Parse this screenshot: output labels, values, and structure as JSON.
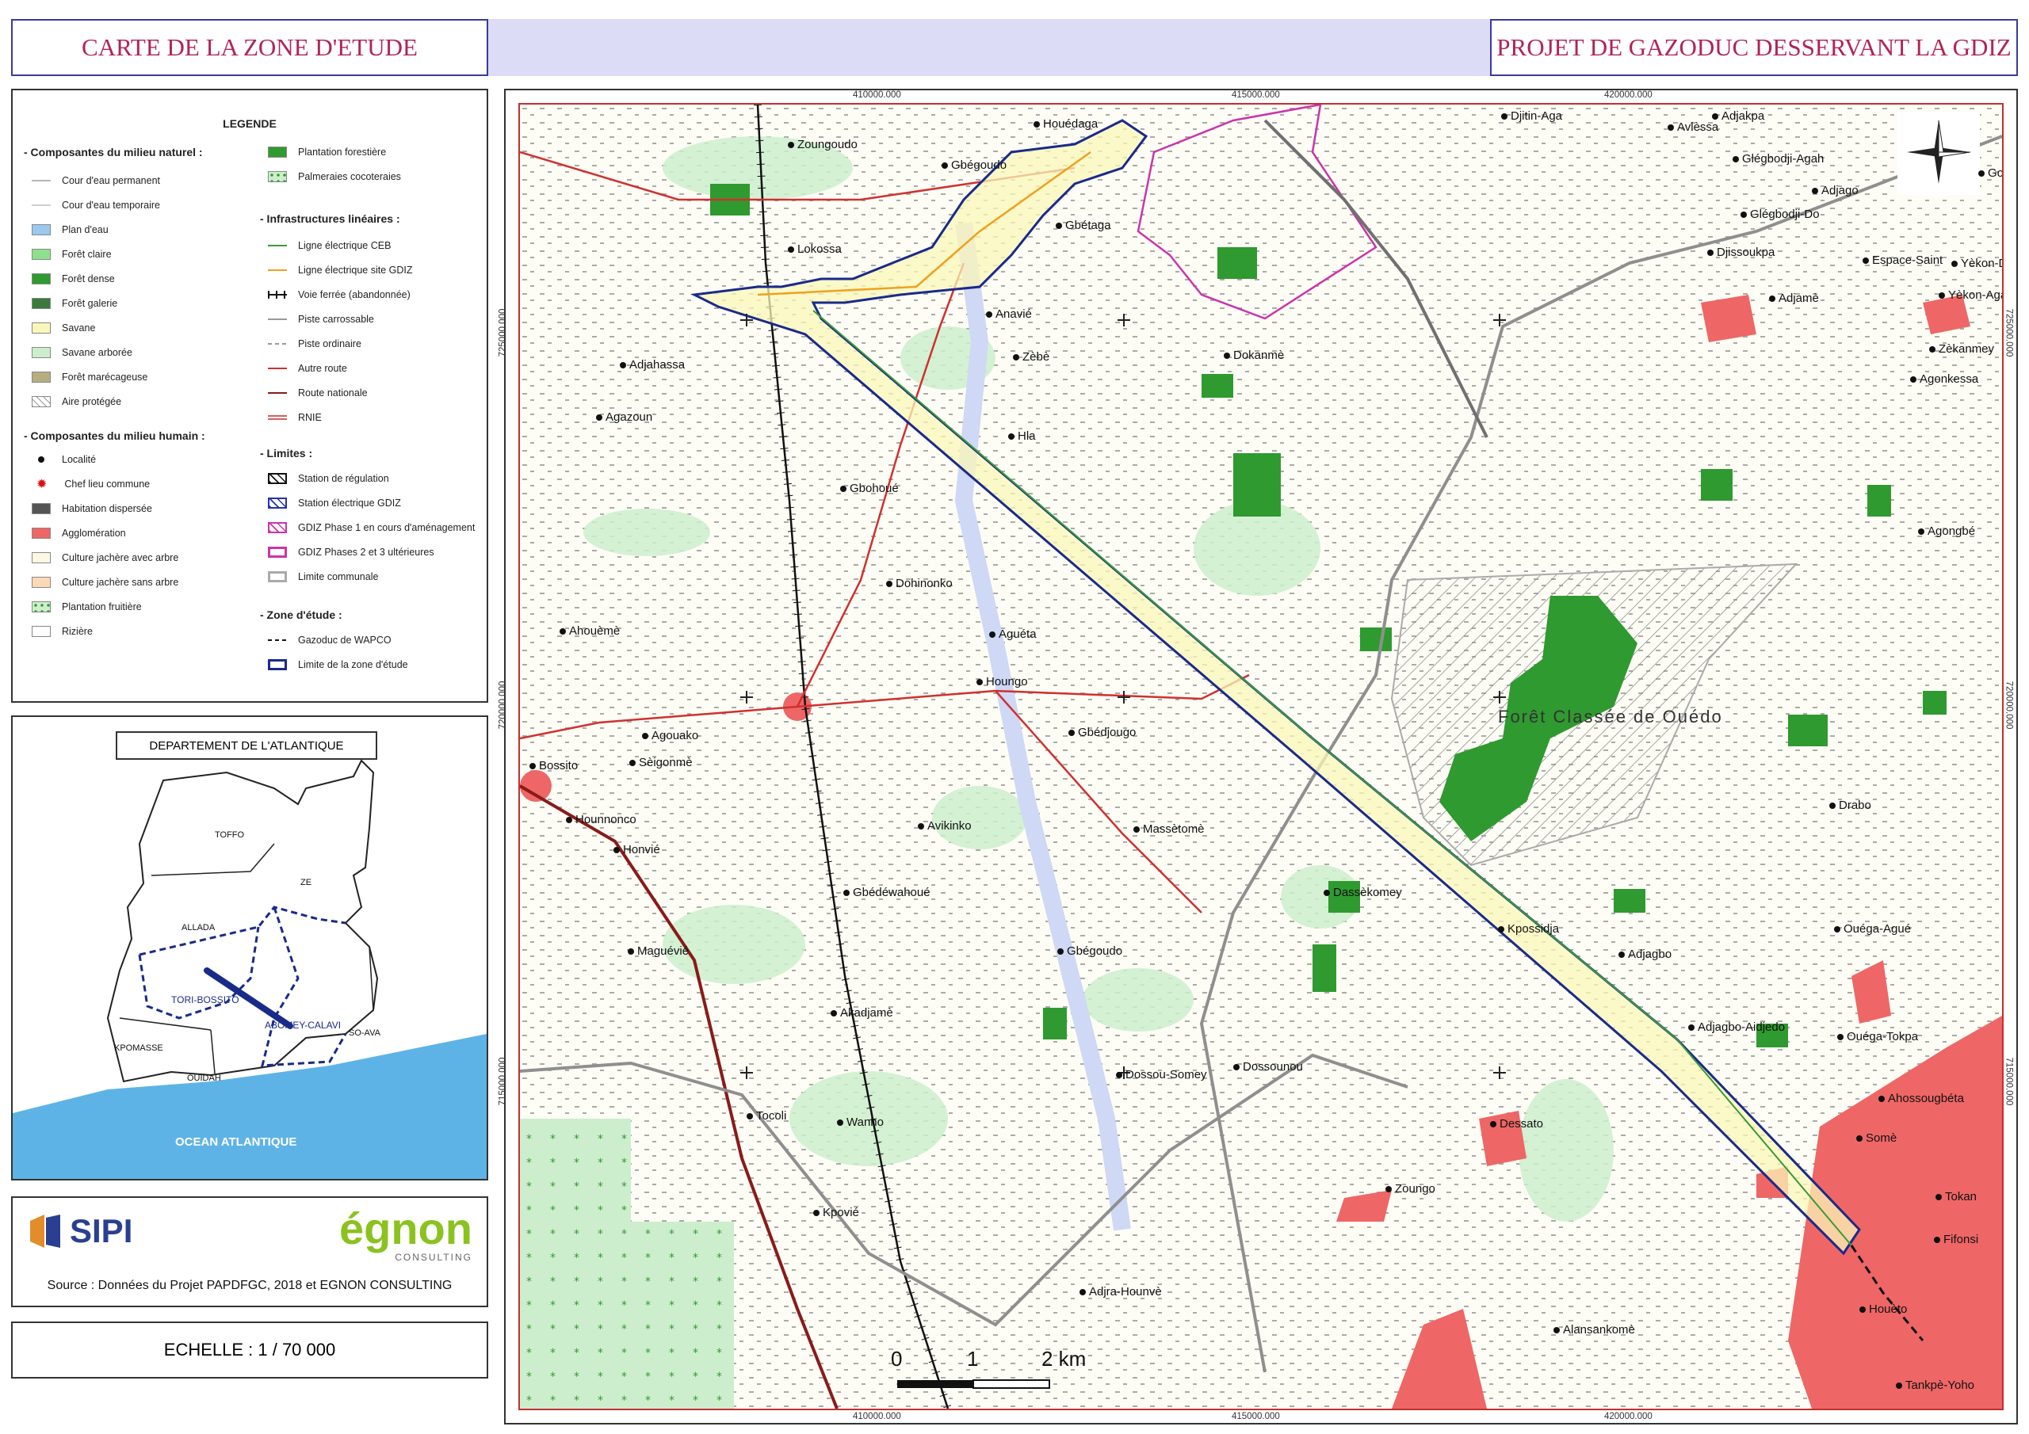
{
  "header": {
    "left_title": "CARTE DE LA ZONE D'ETUDE",
    "right_title": "PROJET DE GAZODUC DESSERVANT LA GDIZ"
  },
  "legend": {
    "title": "LEGENDE",
    "natural": {
      "heading": "- Composantes du milieu naturel :",
      "items": [
        {
          "label": "Cour d'eau permanent",
          "color": "#b5b5b5",
          "kind": "line"
        },
        {
          "label": "Cour d'eau temporaire",
          "color": "#cfcfcf",
          "kind": "line"
        },
        {
          "label": "Plan d'eau",
          "color": "#9ac8ee",
          "kind": "fill"
        },
        {
          "label": "Forêt claire",
          "color": "#8ee08e",
          "kind": "fill"
        },
        {
          "label": "Forêt dense",
          "color": "#2f9a2f",
          "kind": "fill"
        },
        {
          "label": "Forêt galerie",
          "color": "#3a7a3a",
          "kind": "fill"
        },
        {
          "label": "Savane",
          "color": "#fbf7b8",
          "kind": "fill"
        },
        {
          "label": "Savane arborée",
          "color": "#cdeecd",
          "kind": "fill"
        },
        {
          "label": "Forêt marécageuse",
          "color": "#b7ae80",
          "kind": "fill"
        },
        {
          "label": "Aire protégée",
          "color": "#ffffff",
          "kind": "hatch"
        }
      ]
    },
    "human": {
      "heading": "- Composantes du milieu humain :",
      "items": [
        {
          "label": "Localité",
          "color": "#111111",
          "kind": "point"
        },
        {
          "label": "Chef lieu commune",
          "color": "#dd1111",
          "kind": "star"
        },
        {
          "label": "Habitation dispersée",
          "color": "#555555",
          "kind": "fill"
        },
        {
          "label": "Agglomération",
          "color": "#ee6666",
          "kind": "fill"
        },
        {
          "label": "Culture jachère avec arbre",
          "color": "#fdf8e4",
          "kind": "fill"
        },
        {
          "label": "Culture jachère sans arbre",
          "color": "#fcd9b6",
          "kind": "fill"
        },
        {
          "label": "Plantation fruitière",
          "color": "#cdeecd",
          "kind": "dots"
        },
        {
          "label": "Rizière",
          "color": "#ffffff",
          "kind": "fill"
        }
      ]
    },
    "top_right": [
      {
        "label": "Plantation forestière",
        "color": "#2f9a2f",
        "kind": "fill"
      },
      {
        "label": "Palmeraies cocoteraies",
        "color": "#cdeecd",
        "kind": "dots"
      }
    ],
    "linear": {
      "heading": "- Infrastructures linéaires :",
      "items": [
        {
          "label": "Ligne électrique CEB",
          "color": "#3a9a3a",
          "kind": "line"
        },
        {
          "label": "Ligne électrique site GDIZ",
          "color": "#f0a020",
          "kind": "line"
        },
        {
          "label": "Voie ferrée (abandonnée)",
          "color": "#111111",
          "kind": "rail"
        },
        {
          "label": "Piste carrossable",
          "color": "#999999",
          "kind": "line"
        },
        {
          "label": "Piste ordinaire",
          "color": "#999999",
          "kind": "dash"
        },
        {
          "label": "Autre route",
          "color": "#d03030",
          "kind": "line"
        },
        {
          "label": "Route nationale",
          "color": "#8a1a1a",
          "kind": "line"
        },
        {
          "label": "RNIE",
          "color": "#d86060",
          "kind": "double"
        }
      ]
    },
    "limits": {
      "heading": "- Limites :",
      "items": [
        {
          "label": "Station de régulation",
          "color": "#111111",
          "kind": "hatchbox"
        },
        {
          "label": "Station électrique GDIZ",
          "color": "#2233aa",
          "kind": "hatchbox"
        },
        {
          "label": "GDIZ Phase 1 en cours d'aménagement",
          "color": "#cc33aa",
          "kind": "hatchbox"
        },
        {
          "label": "GDIZ Phases 2 et 3 ultérieures",
          "color": "#cc33aa",
          "kind": "box"
        },
        {
          "label": "Limite communale",
          "color": "#aaaaaa",
          "kind": "box"
        }
      ]
    },
    "study": {
      "heading": "- Zone d'étude :",
      "items": [
        {
          "label": "Gazoduc de WAPCO",
          "color": "#111111",
          "kind": "dash"
        },
        {
          "label": "Limite de la zone d'étude",
          "color": "#1a2a8a",
          "kind": "box"
        }
      ]
    }
  },
  "inset": {
    "title": "DEPARTEMENT DE L'ATLANTIQUE",
    "labels": [
      "TOFFO",
      "ZE",
      "ALLADA",
      "TORI-BOSSITO",
      "ABOMEY-CALAVI",
      "SO-AVA",
      "KPOMASSE",
      "OUIDAH",
      "OCEAN ATLANTIQUE"
    ]
  },
  "credits": {
    "sipi": "SIPI",
    "egnon": "égnon",
    "egnon_sub": "CONSULTING",
    "source": "Source : Données du Projet PAPDFGC, 2018 et EGNON CONSULTING"
  },
  "scale": {
    "text": "ECHELLE : 1 / 70 000",
    "bar_labels": [
      "0",
      "1",
      "2 km"
    ]
  },
  "map": {
    "coords_top": [
      "410000.000",
      "415000.000",
      "420000.000"
    ],
    "coords_bottom": [
      "410000.000",
      "415000.000",
      "420000.000"
    ],
    "coords_left": [
      "725000.000",
      "720000.000",
      "715000.000"
    ],
    "coords_right": [
      "725000.000",
      "720000.000",
      "715000.000"
    ],
    "forest_label": "Forêt Classée de Ouédo",
    "places": [
      "Houédaga",
      "Zoungoudo",
      "Gbégoudo",
      "Lokossa",
      "Gbétaga",
      "Anavié",
      "Zèbè",
      "Hla",
      "Adjahassa",
      "Agazoun",
      "Dokanmè",
      "Gbohoué",
      "Dohinonko",
      "Aguéta",
      "Houngo",
      "Gbédjougo",
      "Ahouèmè",
      "Agouako",
      "Sèigonmè",
      "Bossito",
      "Hounnonco",
      "Honvié",
      "Avikinko",
      "Massètomè",
      "Gbédéwahoué",
      "Maguévié",
      "Gbégoudo",
      "Akadjamè",
      "Dossou-Somey",
      "Dossounou",
      "Tocoli",
      "Wanho",
      "Kpovié",
      "Adjra-Hounvè",
      "Zoungo",
      "Dessato",
      "Alansankomè",
      "Dassèkomey",
      "Kpossidja",
      "Adjagbo",
      "Adjagbo-Aidjedo",
      "Djitin-Aga",
      "Avlèssa",
      "Adjakpa",
      "Glégbodji-Agah",
      "Adjago",
      "Glégbodji-Do",
      "Djissoukpa",
      "Espace-Saint",
      "Yèkon-Do",
      "Adjamè",
      "Yèkon-Aga",
      "Zèkanmey",
      "Agonkessa",
      "Agongbé",
      "Drabo",
      "Ouéga-Agué",
      "Ouéga-Tokpa",
      "Ahossougbéta",
      "Somè",
      "Tokan",
      "Fifonsi",
      "Houèto",
      "Tankpè-Yoho",
      "Golo"
    ]
  },
  "colors": {
    "accent_title": "#b0245a",
    "study_zone": "#1a2a8a",
    "dense_forest": "#2f9a2f",
    "agglomeration": "#ee6666",
    "road": "#d03030"
  }
}
